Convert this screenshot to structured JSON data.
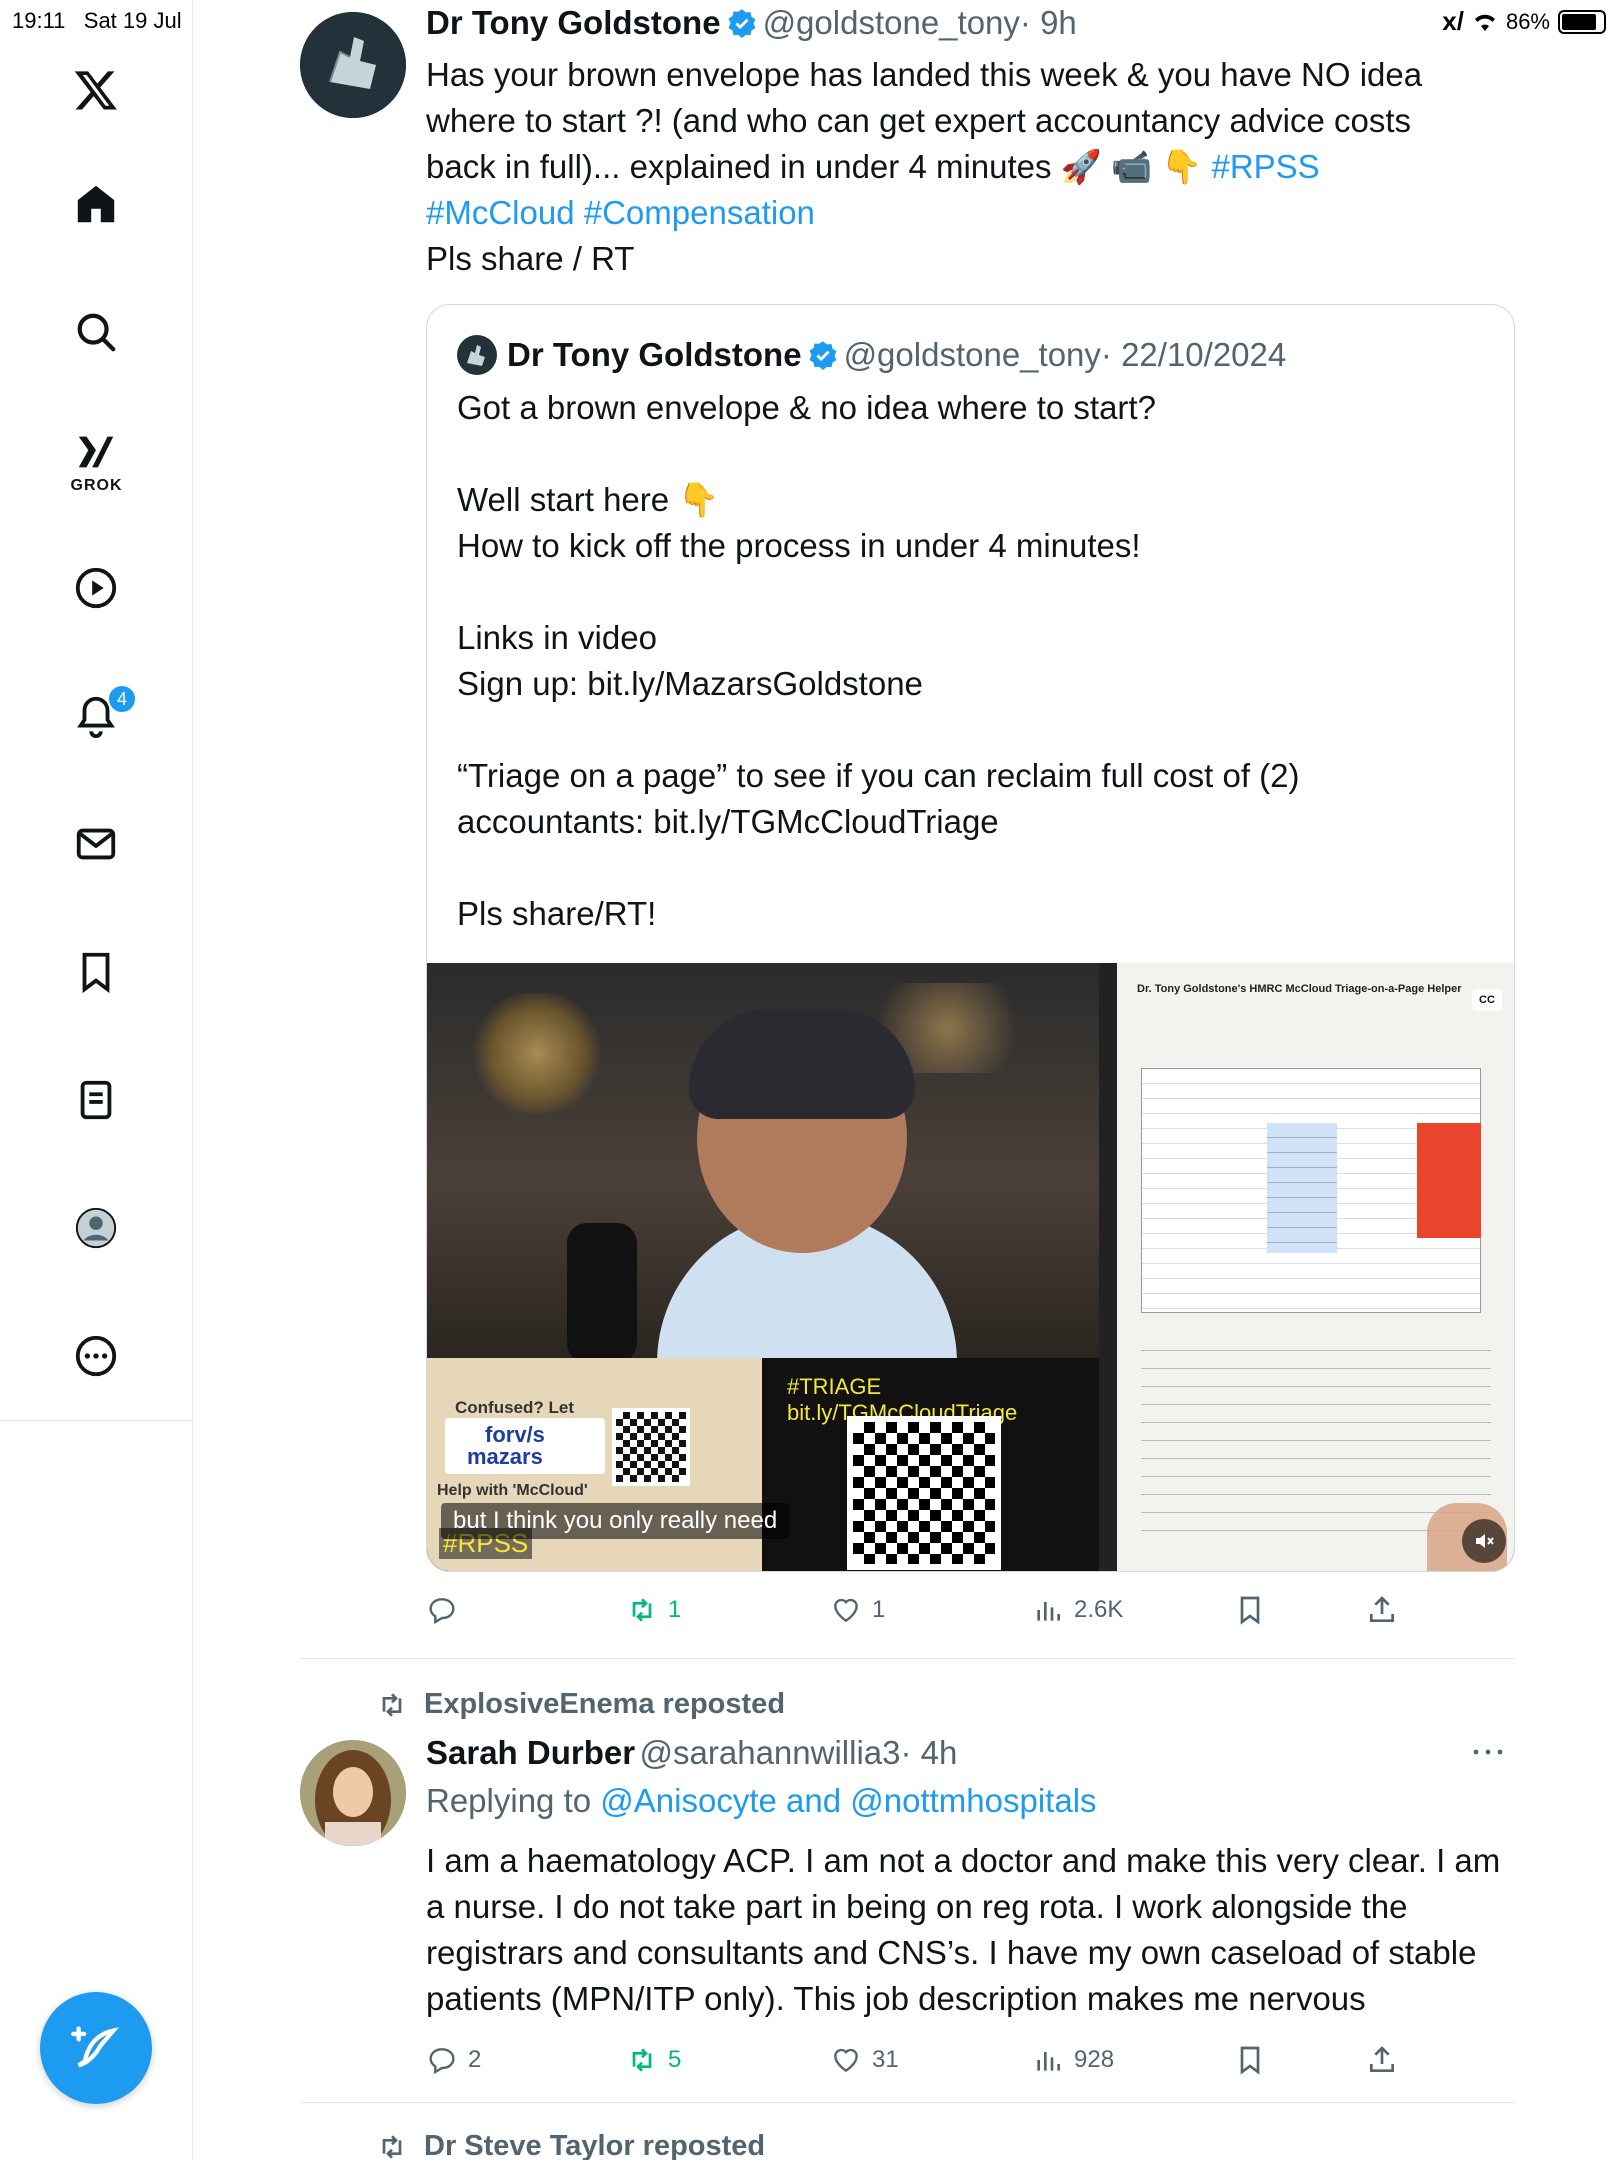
{
  "status_bar": {
    "time": "19:11",
    "date": "Sat 19 Jul",
    "battery": "86%",
    "battery_level": 0.86
  },
  "sidebar": {
    "grok_label": "GROK",
    "notification_count": "4"
  },
  "tweet1": {
    "name": "Dr Tony Goldstone",
    "handle": "@goldstone_tony",
    "time": "· 9h",
    "text_line1": "Has your brown envelope has landed this week & you have NO idea",
    "text_line2": "where to start ?! (and who can get expert accountancy advice costs",
    "text_line3": "back in full)... explained in under 4 minutes 🚀 📹 👇",
    "tag1": "#RPSS",
    "tag2": "#McCloud",
    "tag3": "#Compensation",
    "text_line5": "Pls share / RT",
    "quote": {
      "name": "Dr Tony Goldstone",
      "handle": "@goldstone_tony",
      "time": "· 22/10/2024",
      "text": "Got a brown envelope & no idea where to start?\n\nWell start here 👇\nHow to kick off the process in under 4 minutes!\n\nLinks in video\nSign up: bit.ly/MazarsGoldstone\n\n“Triage on a page” to see if you can reclaim full cost of (2)\naccountants: bit.ly/TGMcCloudTriage\n\nPls share/RT!"
    },
    "video": {
      "caption": "but I think you only really need",
      "overlay_triage": "#TRIAGE bit.ly/TGMcCloudTriage",
      "overlay_rpss": "#RPSS",
      "card_confused": "Confused? Let",
      "card_forvis": "forv/s",
      "card_mazars": "mazars",
      "card_help": "Help with 'McCloud'",
      "doc_title": "Dr. Tony Goldstone's HMRC McCloud Triage-on-a-Page Helper",
      "cc_label": "CC"
    },
    "stats": {
      "replies": "",
      "reposts": "1",
      "likes": "1",
      "views": "2.6K"
    }
  },
  "tweet2": {
    "reposted_by": "ExplosiveEnema reposted",
    "name": "Sarah Durber",
    "handle": "@sarahannwillia3",
    "time": "· 4h",
    "replying_prefix": "Replying to",
    "replying_to": "@Anisocyte and @nottmhospitals",
    "text": "I am a haematology ACP. I am not a doctor and make this very clear. I am a nurse. I do not take part in being on reg rota. I work alongside the registrars and consultants and CNS’s. I have my own caseload of stable patients (MPN/ITP only). This job description makes me nervous",
    "stats": {
      "replies": "2",
      "reposts": "5",
      "likes": "31",
      "views": "928"
    }
  },
  "tweet3": {
    "reposted_by": "Dr Steve Taylor reposted"
  },
  "colors": {
    "accent": "#1d9bf0",
    "repost_green": "#00ba7c",
    "muted": "#536471"
  }
}
